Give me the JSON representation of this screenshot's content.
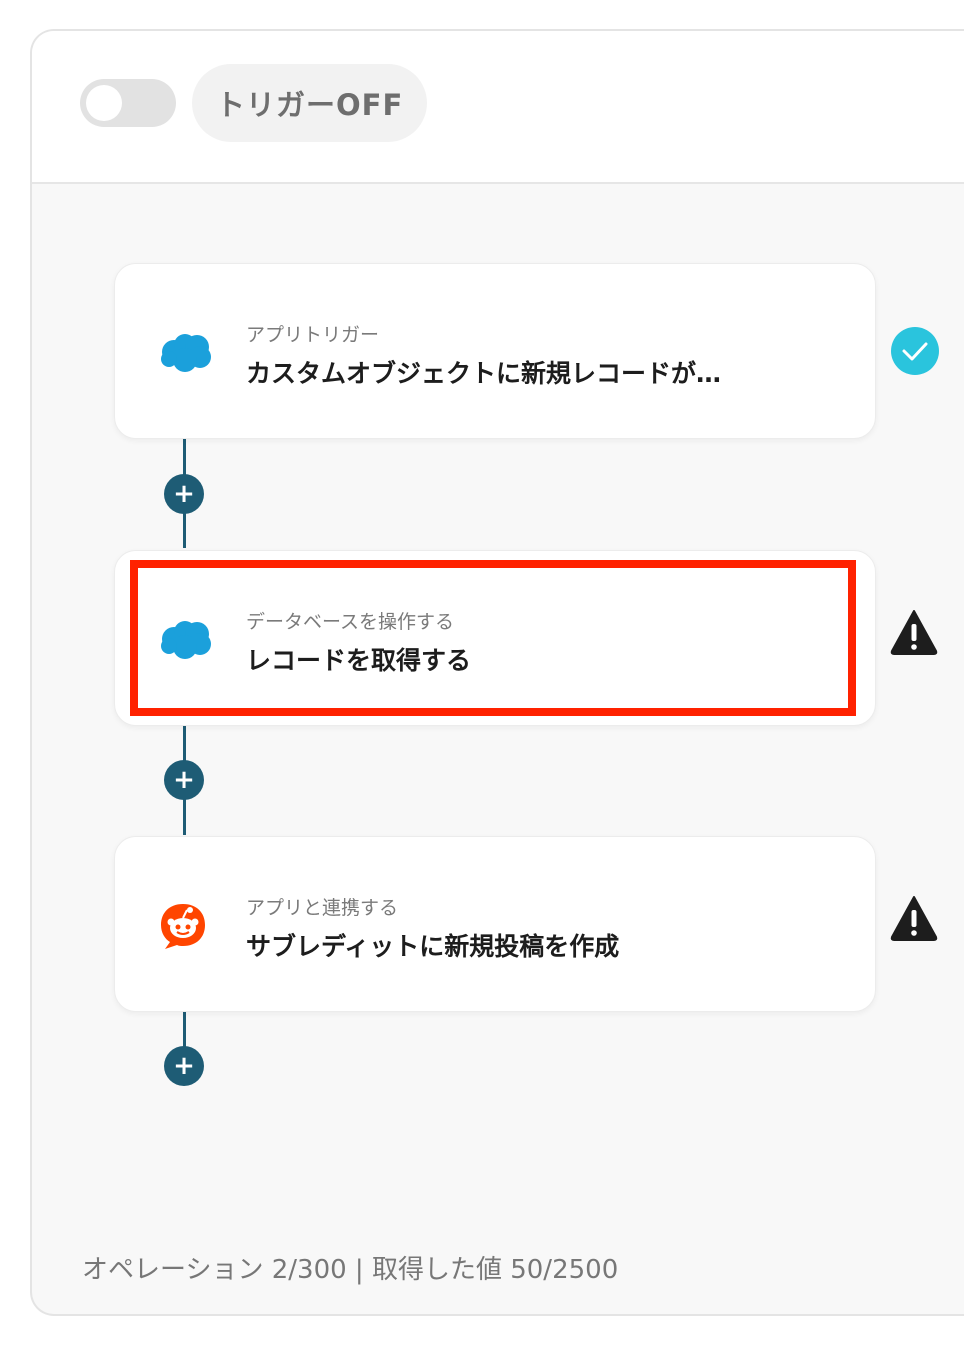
{
  "header": {
    "toggle_state": "off",
    "trigger_label": "トリガーOFF"
  },
  "steps": [
    {
      "app_icon": "salesforce-cloud-icon",
      "label": "アプリトリガー",
      "title": "カスタムオブジェクトに新規レコードが…",
      "status": "check-icon"
    },
    {
      "app_icon": "salesforce-cloud-icon",
      "label": "データベースを操作する",
      "title": "レコードを取得する",
      "status": "warning-icon"
    },
    {
      "app_icon": "reddit-icon",
      "label": "アプリと連携する",
      "title": "サブレディットに新規投稿を作成",
      "status": "warning-icon"
    }
  ],
  "add_step_symbol": "+",
  "footer": {
    "usage_text": "オペレーション 2/300 | 取得した値 50/2500"
  },
  "colors": {
    "connector": "#1e5c75",
    "salesforce": "#1ba0db",
    "reddit": "#ff4500",
    "check": "#2ac4dd",
    "highlight": "#ff2200"
  }
}
